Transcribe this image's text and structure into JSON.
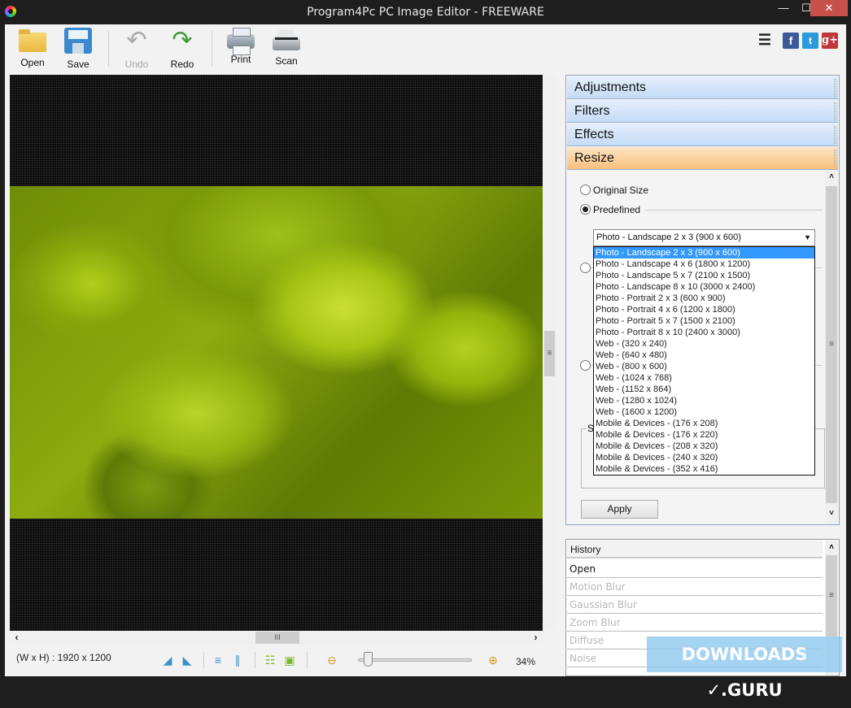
{
  "window": {
    "title": "Program4Pc PC Image Editor - FREEWARE",
    "controls": {
      "minimize": "—",
      "maximize": "☐",
      "close": "✕"
    }
  },
  "toolbar": {
    "open": "Open",
    "save": "Save",
    "undo": "Undo",
    "redo": "Redo",
    "print": "Print",
    "scan": "Scan"
  },
  "social": {
    "menu_icon": "☰",
    "facebook": "f",
    "twitter": "t",
    "googleplus": "g+"
  },
  "panel": {
    "sections": [
      "Adjustments",
      "Filters",
      "Effects",
      "Resize"
    ],
    "active_section": "Resize",
    "resize": {
      "original_size_label": "Original Size",
      "predefined_label": "Predefined",
      "selected_preset": "Photo - Landscape 2 x 3 (900 x 600)",
      "presets": [
        "Photo - Landscape 2 x 3 (900 x 600)",
        "Photo - Landscape 4 x 6 (1800 x 1200)",
        "Photo - Landscape 5 x 7 (2100 x 1500)",
        "Photo - Landscape 8 x 10 (3000 x 2400)",
        "Photo - Portrait 2 x 3 (600 x 900)",
        "Photo - Portrait 4 x 6 (1200 x 1800)",
        "Photo - Portrait 5 x 7 (1500 x 2100)",
        "Photo - Portrait 8 x 10 (2400 x 3000)",
        "Web - (320 x 240)",
        "Web - (640 x 480)",
        "Web - (800 x 600)",
        "Web - (1024 x 768)",
        "Web - (1152 x 864)",
        "Web - (1280 x 1024)",
        "Web - (1600 x 1200)",
        "Mobile & Devices - (176 x 208)",
        "Mobile & Devices - (176 x 220)",
        "Mobile & Devices - (208 x 320)",
        "Mobile & Devices - (240 x 320)",
        "Mobile & Devices - (352 x 416)"
      ],
      "group_label_partial": "S",
      "apply": "Apply"
    }
  },
  "history": {
    "header": "History",
    "items": [
      {
        "label": "Open",
        "current": true
      },
      {
        "label": "Motion Blur",
        "current": false
      },
      {
        "label": "Gaussian Blur",
        "current": false
      },
      {
        "label": "Zoom Blur",
        "current": false
      },
      {
        "label": "Diffuse",
        "current": false
      },
      {
        "label": "Noise",
        "current": false
      }
    ]
  },
  "status": {
    "dimensions": "(W x H) : 1920 x 1200",
    "zoom": "34%",
    "zoom_fraction": 0.05
  },
  "scrollbar_glyphs": {
    "left": "‹",
    "right": "›",
    "up": "˄",
    "down": "˅",
    "grip_v": "≡",
    "grip_h": "III"
  },
  "watermark": "DOWNLOADS ✓.GURU"
}
